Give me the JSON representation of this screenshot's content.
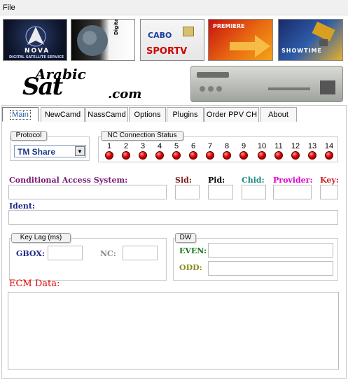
{
  "menu": {
    "file": "File"
  },
  "banner": {
    "cards": [
      {
        "name": "nova",
        "text": "NOVA",
        "subtext": "DIGITAL SATELLITE SERVICE",
        "color": "#ffffff"
      },
      {
        "name": "digital-rtv",
        "text": "Digital RTV",
        "subtext": "",
        "color": "#000000"
      },
      {
        "name": "cabo-sportv",
        "text": "CABO",
        "subtext": "SPORTV",
        "color": "#d00000"
      },
      {
        "name": "premiere",
        "text": "PREMIERE",
        "subtext": "",
        "color": "#ffffff"
      },
      {
        "name": "showtime",
        "text": "SHOWTIME",
        "subtext": "",
        "color": "#ffffff"
      }
    ],
    "logo": {
      "word1": "Arabic",
      "word2": "Sat",
      "domain": ".com"
    }
  },
  "tabs": [
    "Main",
    "NewCamd",
    "NassCamd",
    "Options",
    "Plugins",
    "Order PPV CH",
    "About"
  ],
  "protocol": {
    "title": "Protocol",
    "value": "TM Share"
  },
  "connection": {
    "title": "NC Connection Status",
    "numbers": [
      "1",
      "2",
      "3",
      "4",
      "5",
      "6",
      "7",
      "8",
      "9",
      "10",
      "11",
      "12",
      "13",
      "14"
    ]
  },
  "fields": {
    "cas": "Conditional Access System:",
    "sid": "Sid:",
    "pid": "Pid:",
    "chid": "Chid:",
    "provider": "Provider:",
    "key": "Key:",
    "ident": "Ident:"
  },
  "keylag": {
    "title": "Key Lag  (ms)",
    "gbox": "GBOX:",
    "nc": "NC:"
  },
  "dw": {
    "title": "DW",
    "even": "EVEN:",
    "odd": "ODD:"
  },
  "ecm": {
    "label": "ECM Data:"
  },
  "colors": {
    "cas": "#7a1878",
    "sid": "#7a1818",
    "pid": "#000000",
    "chid": "#1a8a80",
    "provider": "#e000d0",
    "key": "#cc2020",
    "ident": "#1e2a8a",
    "gbox": "#1e2a8a",
    "nc": "#888888",
    "even": "#1a7a1a",
    "odd": "#8a8a1a",
    "ecm": "#e00000",
    "led": "#e10000"
  }
}
